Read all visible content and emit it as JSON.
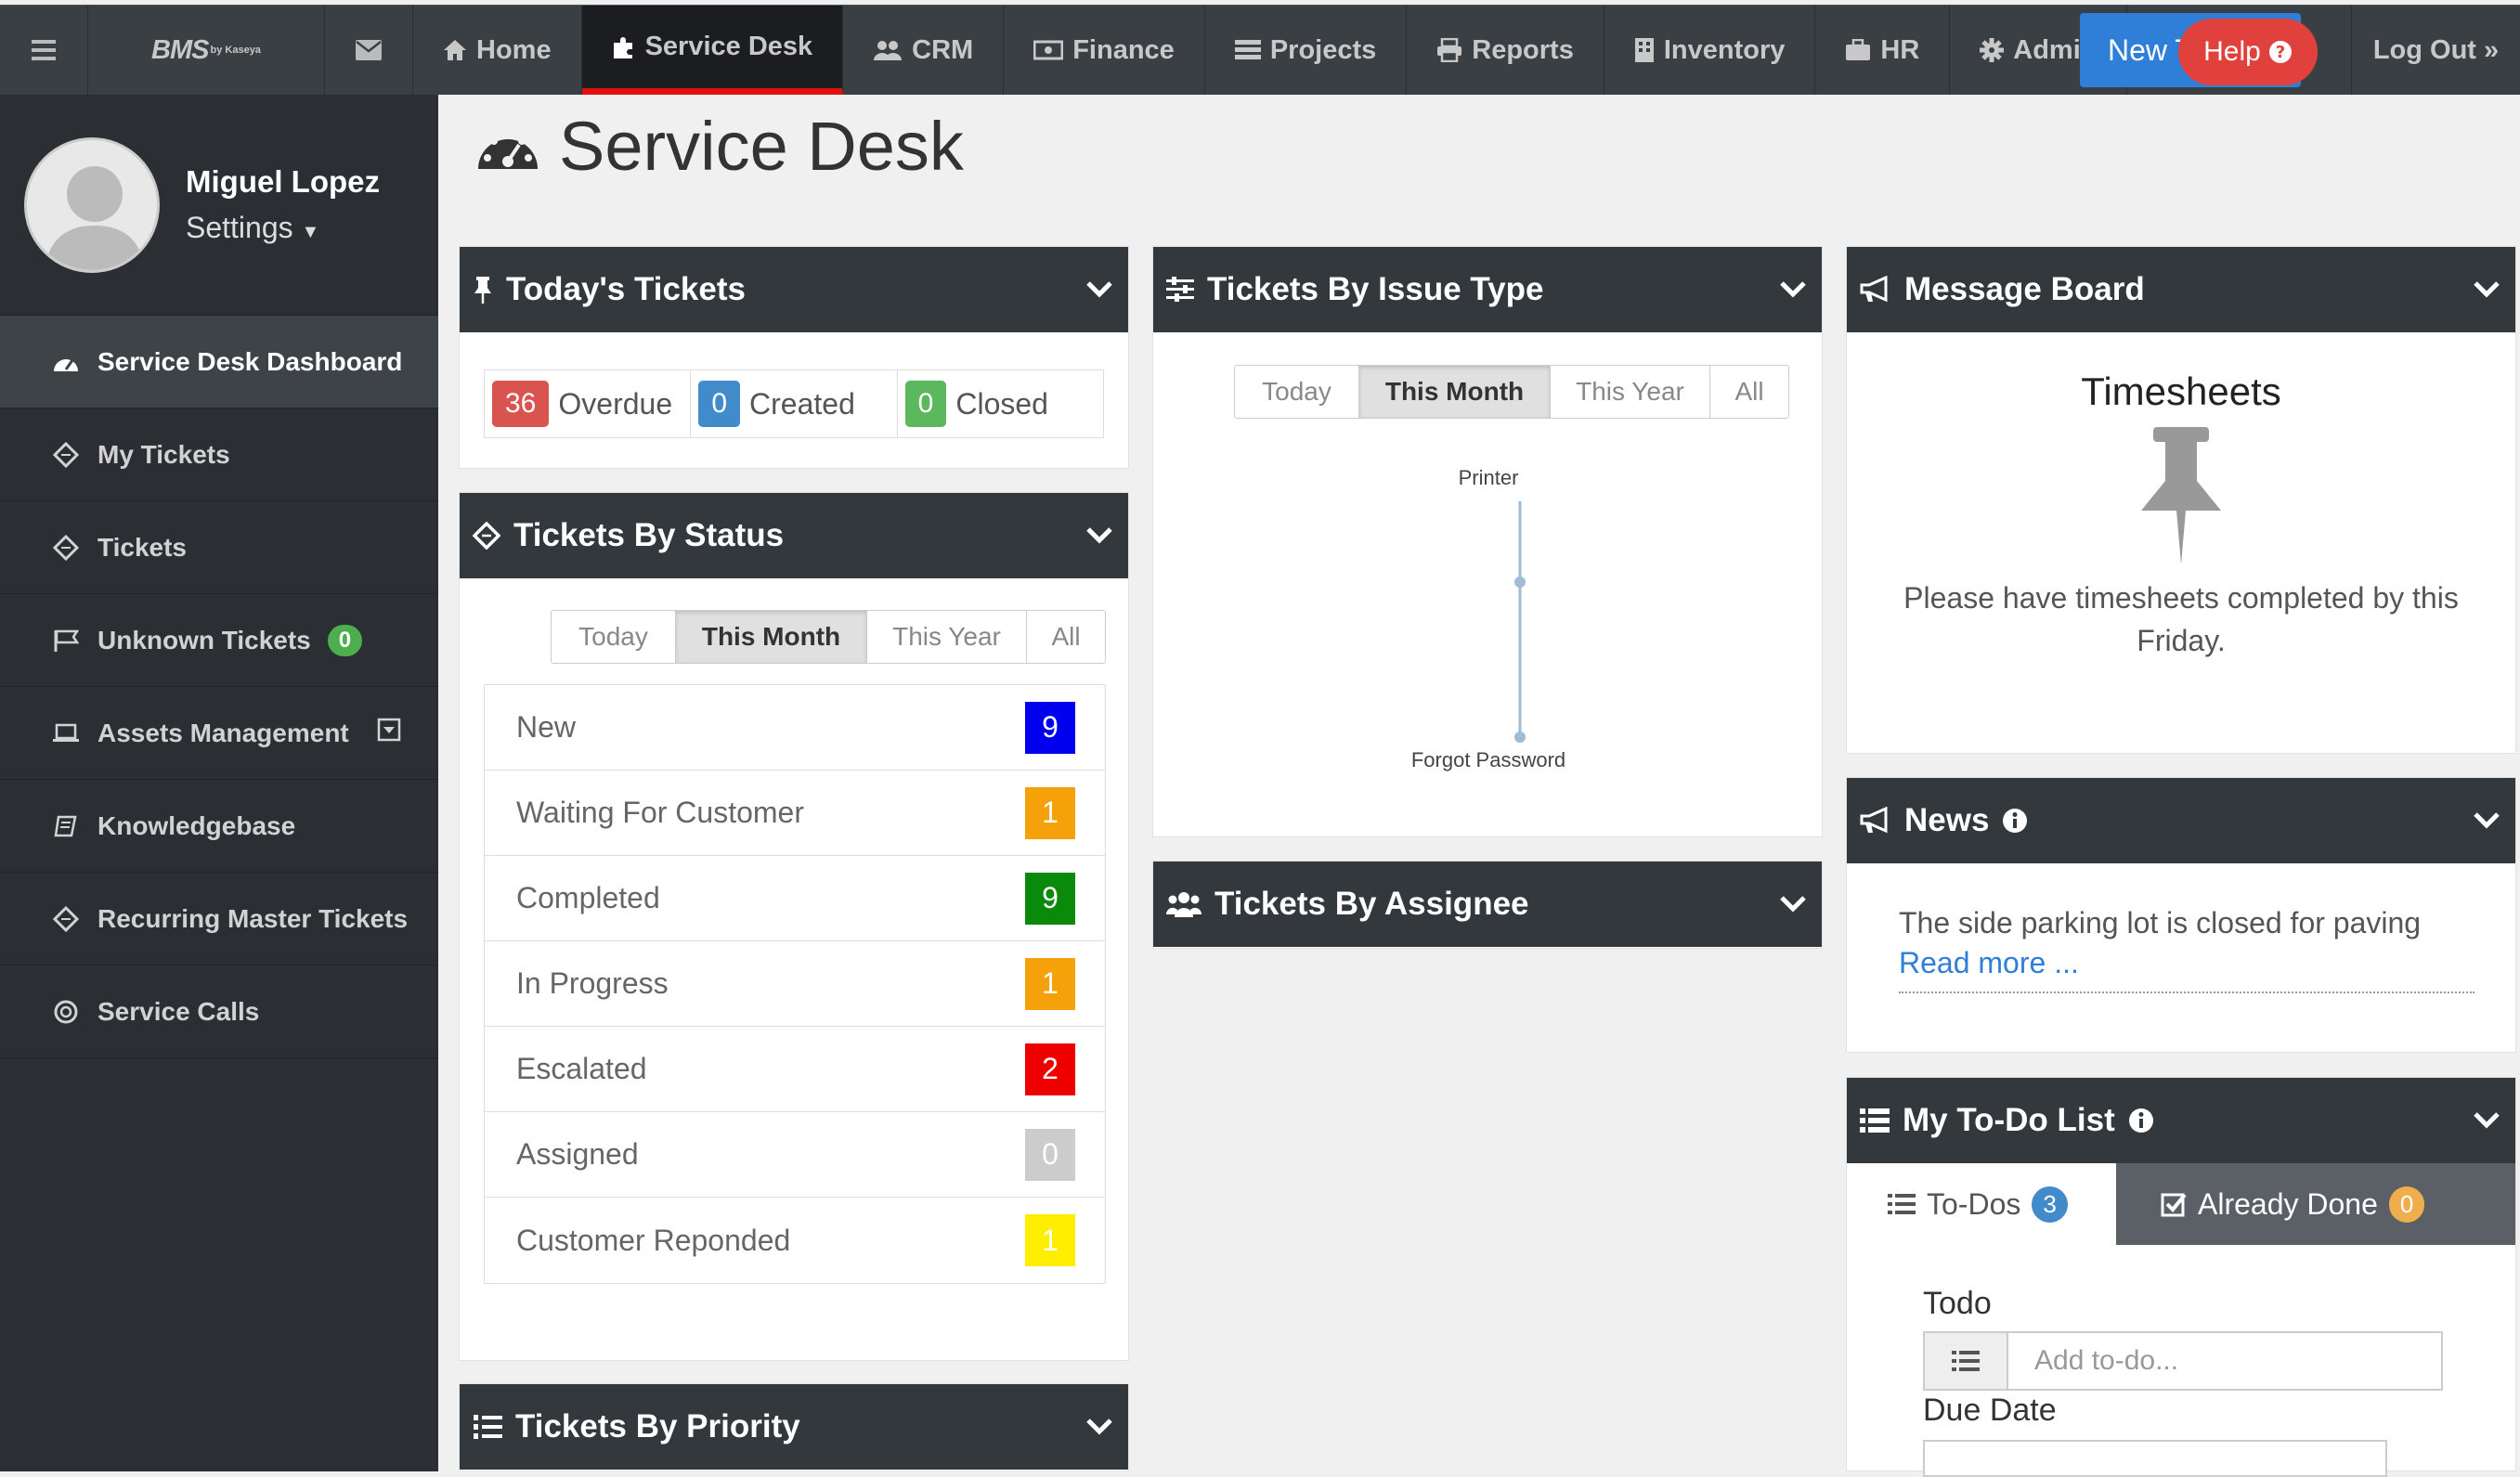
{
  "nav": {
    "logo": "BMS",
    "logo_sub": "by Kaseya",
    "items": [
      {
        "label": "Home",
        "icon": "home-icon"
      },
      {
        "label": "Service Desk",
        "icon": "puzzle-icon",
        "active": true
      },
      {
        "label": "CRM",
        "icon": "users-icon"
      },
      {
        "label": "Finance",
        "icon": "money-icon"
      },
      {
        "label": "Projects",
        "icon": "projects-icon"
      },
      {
        "label": "Reports",
        "icon": "print-icon"
      },
      {
        "label": "Inventory",
        "icon": "building-icon"
      },
      {
        "label": "HR",
        "icon": "briefcase-icon"
      },
      {
        "label": "Admin",
        "icon": "gear-icon"
      }
    ],
    "new_label": "New T",
    "help_label": "Help",
    "logout_label": "Log Out"
  },
  "user": {
    "name": "Miguel Lopez",
    "settings_label": "Settings"
  },
  "sidebar": {
    "items": [
      {
        "label": "Service Desk Dashboard",
        "icon": "dashboard-icon",
        "active": true
      },
      {
        "label": "My Tickets",
        "icon": "ticket-icon"
      },
      {
        "label": "Tickets",
        "icon": "ticket-icon"
      },
      {
        "label": "Unknown Tickets",
        "icon": "flag-icon",
        "badge": "0"
      },
      {
        "label": "Assets Management",
        "icon": "laptop-icon"
      },
      {
        "label": "Knowledgebase",
        "icon": "book-icon"
      },
      {
        "label": "Recurring Master Tickets",
        "icon": "ticket-icon"
      },
      {
        "label": "Service Calls",
        "icon": "lifebuoy-icon"
      }
    ]
  },
  "page_title": "Service Desk",
  "todays_tickets": {
    "title": "Today's Tickets",
    "counters": [
      {
        "value": "36",
        "label": "Overdue",
        "color": "#d9534f"
      },
      {
        "value": "0",
        "label": "Created",
        "color": "#428bca"
      },
      {
        "value": "0",
        "label": "Closed",
        "color": "#5cb85c"
      }
    ]
  },
  "tickets_by_status": {
    "title": "Tickets By Status",
    "filters": [
      "Today",
      "This Month",
      "This Year",
      "All"
    ],
    "active_filter": "This Month",
    "rows": [
      {
        "label": "New",
        "count": "9",
        "color": "#0000ee"
      },
      {
        "label": "Waiting For Customer",
        "count": "1",
        "color": "#f5a20a"
      },
      {
        "label": "Completed",
        "count": "9",
        "color": "#0a8a0a"
      },
      {
        "label": "In Progress",
        "count": "1",
        "color": "#f5a20a"
      },
      {
        "label": "Escalated",
        "count": "2",
        "color": "#ee0000"
      },
      {
        "label": "Assigned",
        "count": "0",
        "color": "#cccccc"
      },
      {
        "label": "Customer Reponded",
        "count": "1",
        "color": "#ffee00"
      }
    ]
  },
  "tickets_by_priority": {
    "title": "Tickets By Priority"
  },
  "tickets_by_issue_type": {
    "title": "Tickets By Issue Type",
    "filters": [
      "Today",
      "This Month",
      "This Year",
      "All"
    ],
    "active_filter": "This Month",
    "chart_labels": [
      "Printer",
      "Forgot Password"
    ]
  },
  "tickets_by_assignee": {
    "title": "Tickets By Assignee"
  },
  "message_board": {
    "title": "Message Board",
    "post_title": "Timesheets",
    "post_body": "Please have timesheets completed by this Friday."
  },
  "news": {
    "title": "News",
    "item": "The side parking lot is closed for paving",
    "read_more": "Read more ..."
  },
  "todo": {
    "title": "My To-Do List",
    "tab_todos": "To-Dos",
    "todos_count": "3",
    "tab_done": "Already Done",
    "done_count": "0",
    "todo_label": "Todo",
    "todo_placeholder": "Add to-do...",
    "due_label": "Due Date"
  },
  "colors": {
    "accent": "#e01010",
    "nav_bg": "#3a3f44",
    "panel_head": "#33383d"
  }
}
